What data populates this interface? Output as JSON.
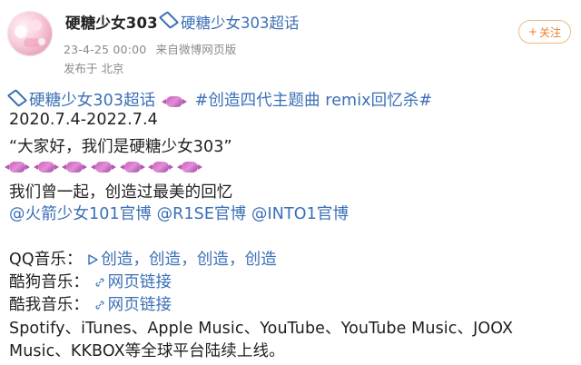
{
  "post": {
    "username": "硬糖少女303",
    "supertopic_inline": "硬糖少女303超话",
    "time": "23-4-25 00:00",
    "source": "来自微博网页版",
    "location": "发布于 北京",
    "follow_label": "关注",
    "follow_plus": "+"
  },
  "content": {
    "line1_tag": "硬糖少女303超话",
    "line1_topic": "#创造四代主题曲 remix回忆杀#",
    "line2": "2020.7.4-2022.7.4",
    "line3": "“大家好，我们是硬糖少女303”",
    "line4_icon_count": 7,
    "line5": "我们曾一起，创造过最美的回忆",
    "mentions": [
      "@火箭少女101官博",
      "@R1SE官博",
      "@INTO1官博"
    ],
    "qq_label": "QQ音乐：",
    "qq_links_text": "创造，创造，创造，创造",
    "kugou_label": "酷狗音乐：",
    "kugou_link": "网页链接",
    "kuwo_label": "酷我音乐：",
    "kuwo_link": "网页链接",
    "line_platforms1": "Spotify、iTunes、Apple Music、YouTube、YouTube Music、JOOX",
    "line_platforms2": "Music、KKBOX等全球平台陆续上线。"
  },
  "colors": {
    "link": "#3b6fb6",
    "follow_orange": "#ef7f2b"
  }
}
